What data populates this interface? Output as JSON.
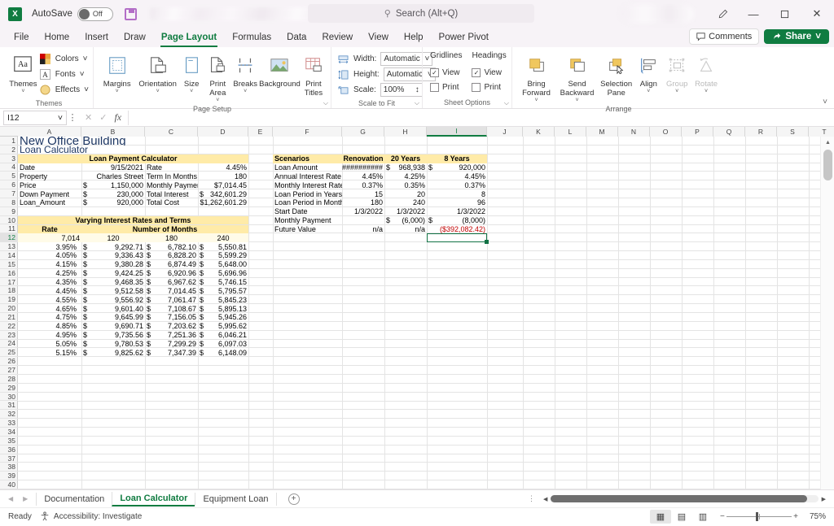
{
  "titlebar": {
    "app_icon": "excel-logo-icon",
    "logo_letter": "X",
    "autosave_label": "AutoSave",
    "autosave_state": "Off",
    "save_icon": "save-icon",
    "search_placeholder": "Search (Alt+Q)",
    "search_icon": "search-icon",
    "pen_icon": "pen-icon",
    "minimize": "—",
    "maximize": "❐",
    "close": "✕"
  },
  "tabs": {
    "items": [
      {
        "label": "File",
        "active": false
      },
      {
        "label": "Home",
        "active": false
      },
      {
        "label": "Insert",
        "active": false
      },
      {
        "label": "Draw",
        "active": false
      },
      {
        "label": "Page Layout",
        "active": true
      },
      {
        "label": "Formulas",
        "active": false
      },
      {
        "label": "Data",
        "active": false
      },
      {
        "label": "Review",
        "active": false
      },
      {
        "label": "View",
        "active": false
      },
      {
        "label": "Help",
        "active": false
      },
      {
        "label": "Power Pivot",
        "active": false
      }
    ],
    "comments_label": "Comments",
    "share_label": "Share",
    "comments_icon": "comment-icon",
    "share_icon": "share-icon",
    "share_caret": "˅"
  },
  "ribbon": {
    "collapse_icon": "chevron-up-icon",
    "groups": [
      {
        "name": "Themes",
        "label": "Themes",
        "buttons": [
          {
            "label": "Themes",
            "icon": "themes-icon",
            "caret": "˅"
          }
        ],
        "small": [
          {
            "label": "Colors",
            "icon": "colors-icon",
            "caret": "˅"
          },
          {
            "label": "Fonts",
            "icon": "fonts-icon",
            "caret": "˅"
          },
          {
            "label": "Effects",
            "icon": "effects-icon",
            "caret": "˅"
          }
        ]
      },
      {
        "name": "Page Setup",
        "label": "Page Setup",
        "buttons": [
          {
            "label": "Margins",
            "icon": "margins-icon",
            "caret": "˅"
          },
          {
            "label": "Orientation",
            "icon": "orientation-icon",
            "caret": "˅"
          },
          {
            "label": "Size",
            "icon": "size-icon",
            "caret": "˅"
          },
          {
            "label": "Print Area",
            "icon": "print-area-icon",
            "caret": "˅"
          },
          {
            "label": "Breaks",
            "icon": "breaks-icon",
            "caret": "˅"
          },
          {
            "label": "Background",
            "icon": "background-icon",
            "caret": ""
          },
          {
            "label": "Print Titles",
            "icon": "print-titles-icon",
            "caret": ""
          }
        ],
        "launcher": "⌵"
      },
      {
        "name": "Scale to Fit",
        "label": "Scale to Fit",
        "rows": [
          {
            "label": "Width:",
            "value": "Automatic",
            "icon": "width-icon"
          },
          {
            "label": "Height:",
            "value": "Automatic",
            "icon": "height-icon"
          },
          {
            "label": "Scale:",
            "value": "100%",
            "icon": "scale-icon"
          }
        ],
        "launcher": "⌵"
      },
      {
        "name": "Sheet Options",
        "label": "Sheet Options",
        "columns": [
          {
            "header": "Gridlines",
            "options": [
              {
                "label": "View",
                "checked": true
              },
              {
                "label": "Print",
                "checked": false
              }
            ]
          },
          {
            "header": "Headings",
            "options": [
              {
                "label": "View",
                "checked": true
              },
              {
                "label": "Print",
                "checked": false
              }
            ]
          }
        ],
        "launcher": "⌵"
      },
      {
        "name": "Arrange",
        "label": "Arrange",
        "buttons": [
          {
            "label": "Bring Forward",
            "icon": "bring-forward-icon",
            "caret": "˅",
            "disabled": false
          },
          {
            "label": "Send Backward",
            "icon": "send-backward-icon",
            "caret": "˅",
            "disabled": false
          },
          {
            "label": "Selection Pane",
            "icon": "selection-pane-icon",
            "caret": "",
            "disabled": false
          },
          {
            "label": "Align",
            "icon": "align-icon",
            "caret": "˅",
            "disabled": false
          },
          {
            "label": "Group",
            "icon": "group-icon",
            "caret": "˅",
            "disabled": true
          },
          {
            "label": "Rotate",
            "icon": "rotate-icon",
            "caret": "˅",
            "disabled": true
          }
        ]
      }
    ]
  },
  "formulabar": {
    "namebox_value": "I12",
    "namebox_caret": "˅",
    "more_icon": "vertical-dots-icon",
    "cancel_icon": "✕",
    "enter_icon": "✓",
    "fx_label": "fx",
    "formula_value": ""
  },
  "grid": {
    "columns": [
      "A",
      "B",
      "C",
      "D",
      "E",
      "F",
      "G",
      "H",
      "I",
      "J",
      "K",
      "L",
      "M",
      "N",
      "O",
      "P",
      "Q",
      "R",
      "S",
      "T"
    ],
    "selected_column": "I",
    "selected_row": 12,
    "rows": [
      1,
      2,
      3,
      4,
      5,
      6,
      7,
      8,
      9,
      10,
      11,
      12,
      13,
      14,
      15,
      16,
      17,
      18,
      19,
      20,
      21,
      22,
      23,
      24,
      25,
      26,
      27,
      28,
      29,
      30,
      31,
      32,
      33,
      34,
      35,
      36,
      37,
      38,
      39,
      40
    ],
    "titles": {
      "main": "New Office Building",
      "sub": "Loan Calculator"
    },
    "loan_calculator": {
      "header": "Loan Payment Calculator",
      "rows": [
        {
          "label": "Date",
          "value": "9/15/2021",
          "label2": "Rate",
          "value2": "4.45%"
        },
        {
          "label": "Property",
          "value": "Charles Street",
          "label2": "Term In Months",
          "value2": "180"
        },
        {
          "label": "Price",
          "sym": "$",
          "value": "1,150,000",
          "label2": "Monthly Payment",
          "value2": "$7,014.45"
        },
        {
          "label": "Down Payment",
          "sym": "$",
          "value": "230,000",
          "label2": "Total Interest",
          "sym2": "$",
          "value2": "342,601.29"
        },
        {
          "label": "Loan_Amount",
          "sym": "$",
          "value": "920,000",
          "label2": "Total Cost",
          "value2": "$1,262,601.29"
        }
      ]
    },
    "varying_table": {
      "header": "Varying Interest Rates and Terms",
      "subheader_rate": "Rate",
      "subheader_months": "Number of Months",
      "corner_sym": "$",
      "corner_value": "7,014",
      "month_cols": [
        "120",
        "180",
        "240"
      ],
      "rows": [
        {
          "rate": "3.95%",
          "v120": "9,292.71",
          "v180": "6,782.10",
          "v240": "5,550.81"
        },
        {
          "rate": "4.05%",
          "v120": "9,336.43",
          "v180": "6,828.20",
          "v240": "5,599.29"
        },
        {
          "rate": "4.15%",
          "v120": "9,380.28",
          "v180": "6,874.49",
          "v240": "5,648.00"
        },
        {
          "rate": "4.25%",
          "v120": "9,424.25",
          "v180": "6,920.96",
          "v240": "5,696.96"
        },
        {
          "rate": "4.35%",
          "v120": "9,468.35",
          "v180": "6,967.62",
          "v240": "5,746.15"
        },
        {
          "rate": "4.45%",
          "v120": "9,512.58",
          "v180": "7,014.45",
          "v240": "5,795.57"
        },
        {
          "rate": "4.55%",
          "v120": "9,556.92",
          "v180": "7,061.47",
          "v240": "5,845.23"
        },
        {
          "rate": "4.65%",
          "v120": "9,601.40",
          "v180": "7,108.67",
          "v240": "5,895.13"
        },
        {
          "rate": "4.75%",
          "v120": "9,645.99",
          "v180": "7,156.05",
          "v240": "5,945.26"
        },
        {
          "rate": "4.85%",
          "v120": "9,690.71",
          "v180": "7,203.62",
          "v240": "5,995.62"
        },
        {
          "rate": "4.95%",
          "v120": "9,735.56",
          "v180": "7,251.36",
          "v240": "6,046.21"
        },
        {
          "rate": "5.05%",
          "v120": "9,780.53",
          "v180": "7,299.29",
          "v240": "6,097.03"
        },
        {
          "rate": "5.15%",
          "v120": "9,825.62",
          "v180": "7,347.39",
          "v240": "6,148.09"
        }
      ]
    },
    "scenarios": {
      "header": "Scenarios",
      "columns": [
        "Renovation",
        "20 Years",
        "8 Years"
      ],
      "rows": [
        {
          "label": "Loan Amount",
          "c1": "##########",
          "c2_sym": "$",
          "c2": "968,938",
          "c3_sym": "$",
          "c3": "920,000"
        },
        {
          "label": "Annual Interest Rate",
          "c1": "4.45%",
          "c2": "4.25%",
          "c3": "4.45%"
        },
        {
          "label": "Monthly Interest Rate",
          "c1": "0.37%",
          "c2": "0.35%",
          "c3": "0.37%"
        },
        {
          "label": "Loan Period in Years",
          "c1": "15",
          "c2": "20",
          "c3": "8"
        },
        {
          "label": "Loan Period in Months",
          "c1": "180",
          "c2": "240",
          "c3": "96"
        },
        {
          "label": "Start Date",
          "c1": "1/3/2022",
          "c2": "1/3/2022",
          "c3": "1/3/2022"
        },
        {
          "label": "Monthly Payment",
          "c1": "",
          "c2_sym": "$",
          "c2": "(6,000)",
          "c3_sym": "$",
          "c3": "(8,000)"
        },
        {
          "label": "Future Value",
          "c1": "n/a",
          "c2": "n/a",
          "c3": "($392,082.42)",
          "c3_red": true
        }
      ]
    }
  },
  "sheettabs": {
    "prev_icon": "◀",
    "next_icon": "▶",
    "items": [
      {
        "label": "Documentation",
        "active": false
      },
      {
        "label": "Loan Calculator",
        "active": true
      },
      {
        "label": "Equipment Loan",
        "active": false
      }
    ],
    "add_label": "+",
    "add_icon": "add-sheet-icon"
  },
  "statusbar": {
    "status": "Ready",
    "accessibility": "Accessibility: Investigate",
    "accessibility_icon": "accessibility-icon",
    "views": [
      {
        "name": "normal-view",
        "glyph": "▦",
        "active": true
      },
      {
        "name": "page-layout-view",
        "glyph": "▤",
        "active": false
      },
      {
        "name": "page-break-view",
        "glyph": "▥",
        "active": false
      }
    ],
    "zoom_out": "−",
    "zoom_in": "+",
    "zoom_level": "75%"
  }
}
